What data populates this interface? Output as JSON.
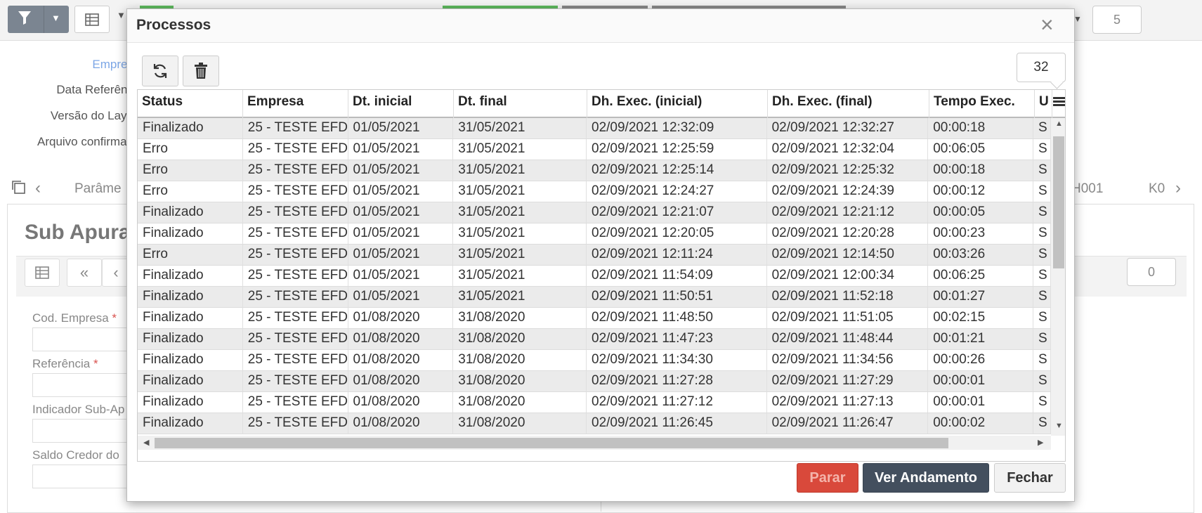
{
  "background": {
    "top_counter": "5",
    "labels": [
      "Empres",
      "Data Referênc",
      "Versão do Layo",
      "Arquivo confirmad"
    ],
    "tabs": [
      "Parâme",
      "H001",
      "K0"
    ],
    "sub_title": "Sub Apura",
    "counter2": "0",
    "fields": [
      "Cod. Empresa",
      "Referência",
      "Indicador Sub-Ap",
      "Saldo Credor do"
    ],
    "required_mark": "*"
  },
  "modal": {
    "title": "Processos",
    "close_glyph": "×",
    "record_count": "32",
    "columns": [
      "Status",
      "Empresa",
      "Dt. inicial",
      "Dt. final",
      "Dh. Exec. (inicial)",
      "Dh. Exec. (final)",
      "Tempo Exec.",
      "U"
    ],
    "rows": [
      [
        "Finalizado",
        "25 - TESTE EFD",
        "01/05/2021",
        "31/05/2021",
        "02/09/2021 12:32:09",
        "02/09/2021 12:32:27",
        "00:00:18",
        "S"
      ],
      [
        "Erro",
        "25 - TESTE EFD",
        "01/05/2021",
        "31/05/2021",
        "02/09/2021 12:25:59",
        "02/09/2021 12:32:04",
        "00:06:05",
        "S"
      ],
      [
        "Erro",
        "25 - TESTE EFD",
        "01/05/2021",
        "31/05/2021",
        "02/09/2021 12:25:14",
        "02/09/2021 12:25:32",
        "00:00:18",
        "S"
      ],
      [
        "Erro",
        "25 - TESTE EFD",
        "01/05/2021",
        "31/05/2021",
        "02/09/2021 12:24:27",
        "02/09/2021 12:24:39",
        "00:00:12",
        "S"
      ],
      [
        "Finalizado",
        "25 - TESTE EFD",
        "01/05/2021",
        "31/05/2021",
        "02/09/2021 12:21:07",
        "02/09/2021 12:21:12",
        "00:00:05",
        "S"
      ],
      [
        "Finalizado",
        "25 - TESTE EFD",
        "01/05/2021",
        "31/05/2021",
        "02/09/2021 12:20:05",
        "02/09/2021 12:20:28",
        "00:00:23",
        "S"
      ],
      [
        "Erro",
        "25 - TESTE EFD",
        "01/05/2021",
        "31/05/2021",
        "02/09/2021 12:11:24",
        "02/09/2021 12:14:50",
        "00:03:26",
        "S"
      ],
      [
        "Finalizado",
        "25 - TESTE EFD",
        "01/05/2021",
        "31/05/2021",
        "02/09/2021 11:54:09",
        "02/09/2021 12:00:34",
        "00:06:25",
        "S"
      ],
      [
        "Finalizado",
        "25 - TESTE EFD",
        "01/05/2021",
        "31/05/2021",
        "02/09/2021 11:50:51",
        "02/09/2021 11:52:18",
        "00:01:27",
        "S"
      ],
      [
        "Finalizado",
        "25 - TESTE EFD",
        "01/08/2020",
        "31/08/2020",
        "02/09/2021 11:48:50",
        "02/09/2021 11:51:05",
        "00:02:15",
        "S"
      ],
      [
        "Finalizado",
        "25 - TESTE EFD",
        "01/08/2020",
        "31/08/2020",
        "02/09/2021 11:47:23",
        "02/09/2021 11:48:44",
        "00:01:21",
        "S"
      ],
      [
        "Finalizado",
        "25 - TESTE EFD",
        "01/08/2020",
        "31/08/2020",
        "02/09/2021 11:34:30",
        "02/09/2021 11:34:56",
        "00:00:26",
        "S"
      ],
      [
        "Finalizado",
        "25 - TESTE EFD",
        "01/08/2020",
        "31/08/2020",
        "02/09/2021 11:27:28",
        "02/09/2021 11:27:29",
        "00:00:01",
        "S"
      ],
      [
        "Finalizado",
        "25 - TESTE EFD",
        "01/08/2020",
        "31/08/2020",
        "02/09/2021 11:27:12",
        "02/09/2021 11:27:13",
        "00:00:01",
        "S"
      ],
      [
        "Finalizado",
        "25 - TESTE EFD",
        "01/08/2020",
        "31/08/2020",
        "02/09/2021 11:26:45",
        "02/09/2021 11:26:47",
        "00:00:02",
        "S"
      ]
    ],
    "buttons": {
      "stop": "Parar",
      "progress": "Ver Andamento",
      "close": "Fechar"
    },
    "toolbar_icons": [
      "refresh-icon",
      "trash-icon"
    ]
  }
}
